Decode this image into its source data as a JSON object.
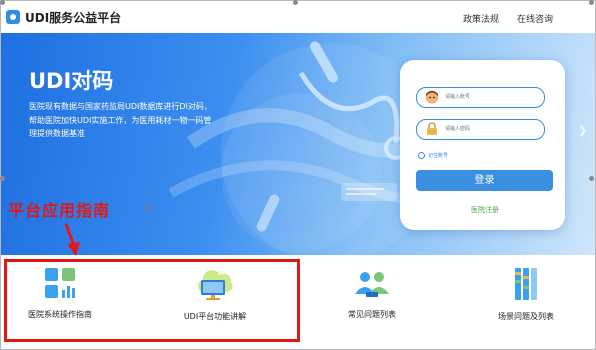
{
  "header": {
    "brand": "UDI服务公益平台",
    "nav": [
      "政策法规",
      "在线咨询"
    ]
  },
  "hero": {
    "title": "UDI对码",
    "description": "医院现有数据与国家药监局UDI数据库进行DI对码，帮助医院加快UDI实施工作，为医用耗材一物一码管理提供数据基准"
  },
  "login": {
    "account_placeholder": "请输入账号",
    "password_placeholder": "请输入密码",
    "remember": "记住账号",
    "login_button": "登录",
    "register": "医院注册"
  },
  "guide": {
    "title": "平台应用指南",
    "mark": "↵"
  },
  "cards": [
    {
      "label": "医院系统操作指南",
      "icon": "hospital-guide-icon"
    },
    {
      "label": "UDI平台功能讲解",
      "icon": "platform-feature-icon"
    },
    {
      "label": "常见问题列表",
      "icon": "faq-people-icon"
    },
    {
      "label": "场景问题及列表",
      "icon": "scenario-list-icon"
    }
  ],
  "colors": {
    "accent": "#2f8de4",
    "annotation": "#e11818",
    "register": "#4aa84a"
  }
}
